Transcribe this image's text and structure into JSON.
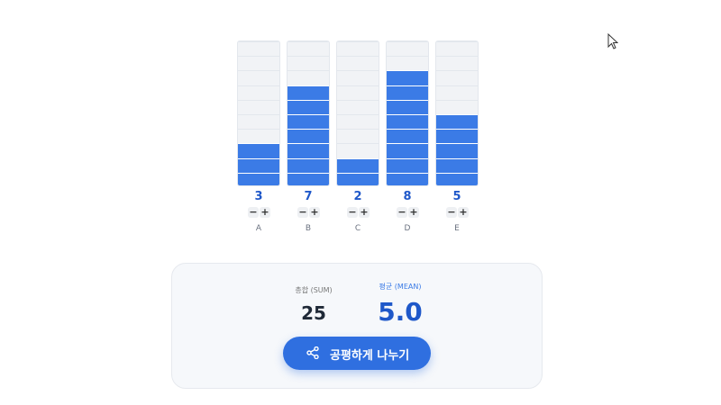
{
  "chart_data": {
    "type": "bar",
    "categories": [
      "A",
      "B",
      "C",
      "D",
      "E"
    ],
    "values": [
      3,
      7,
      2,
      8,
      5
    ],
    "ylim": [
      0,
      10
    ]
  },
  "controls": {
    "minus_label": "−",
    "plus_label": "+"
  },
  "summary": {
    "sum_label": "총합 (SUM)",
    "sum_value": "25",
    "mean_label": "평균 (MEAN)",
    "mean_value": "5.0"
  },
  "share_button": {
    "label": "공평하게 나누기",
    "icon": "share-icon"
  },
  "colors": {
    "accent": "#3b7be6",
    "value_text": "#1f58c9",
    "button": "#2f6fe0"
  }
}
